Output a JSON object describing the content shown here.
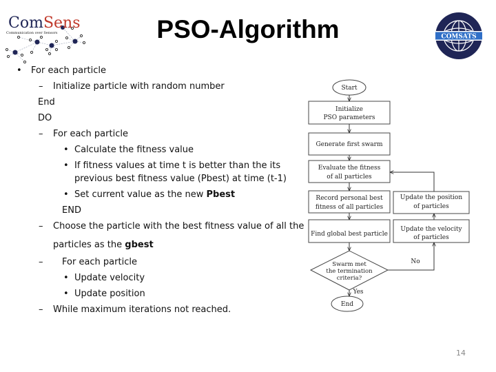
{
  "slide": {
    "title": "PSO-Algorithm",
    "page_number": "14"
  },
  "logos": {
    "left": {
      "brand": "ComSens",
      "brand_part1": "Com",
      "brand_part2": "Sens",
      "tagline": "Communication over Sensors",
      "icon": "sensor-network-icon"
    },
    "right": {
      "brand": "COMSATS",
      "icon": "globe-icon",
      "colors": {
        "circle": "#1f2556",
        "banner": "#2f6fc7",
        "text": "#ffffff"
      }
    }
  },
  "content": {
    "lines": [
      {
        "marker": "•",
        "text": "For each particle"
      },
      {
        "marker": "–",
        "text": "Initialize particle with random number"
      },
      {
        "marker": "",
        "text": "End"
      },
      {
        "marker": "",
        "text": "DO"
      },
      {
        "marker": "–",
        "text": "For each particle"
      },
      {
        "marker": "•",
        "text": "Calculate the fitness value"
      },
      {
        "marker": "•",
        "text": "If fitness values  at time t is better than the its"
      },
      {
        "marker": "",
        "text": "previous best fitness value (Pbest)  at time (t-1)"
      },
      {
        "marker": "•",
        "text": "Set current value as the new ",
        "bold": "Pbest"
      },
      {
        "marker": "",
        "text": "END"
      },
      {
        "marker": "–",
        "text": "Choose the particle with the best fitness value of all the"
      },
      {
        "marker": "",
        "text": "particles as the ",
        "bold": "gbest"
      },
      {
        "marker": "–",
        "text": "For each particle"
      },
      {
        "marker": "•",
        "text": "Update velocity"
      },
      {
        "marker": "•",
        "text": "Update position"
      },
      {
        "marker": "–",
        "text": "While maximum iterations not reached."
      }
    ]
  },
  "flowchart": {
    "start": "Start",
    "init": [
      "Initialize",
      "PSO parameters"
    ],
    "generate": "Generate first swarm",
    "evaluate": [
      "Evaluate the fitness",
      "of all particles"
    ],
    "record": [
      "Record personal best",
      "fitness of all particles"
    ],
    "find_global": "Find global best particle",
    "decision": [
      "Swarm met",
      "the termination",
      "criteria?"
    ],
    "no_label": "No",
    "yes_label": "Yes",
    "end": "End",
    "update_position": [
      "Update the position",
      "of particles"
    ],
    "update_velocity": [
      "Update the velocity",
      "of particles"
    ]
  }
}
